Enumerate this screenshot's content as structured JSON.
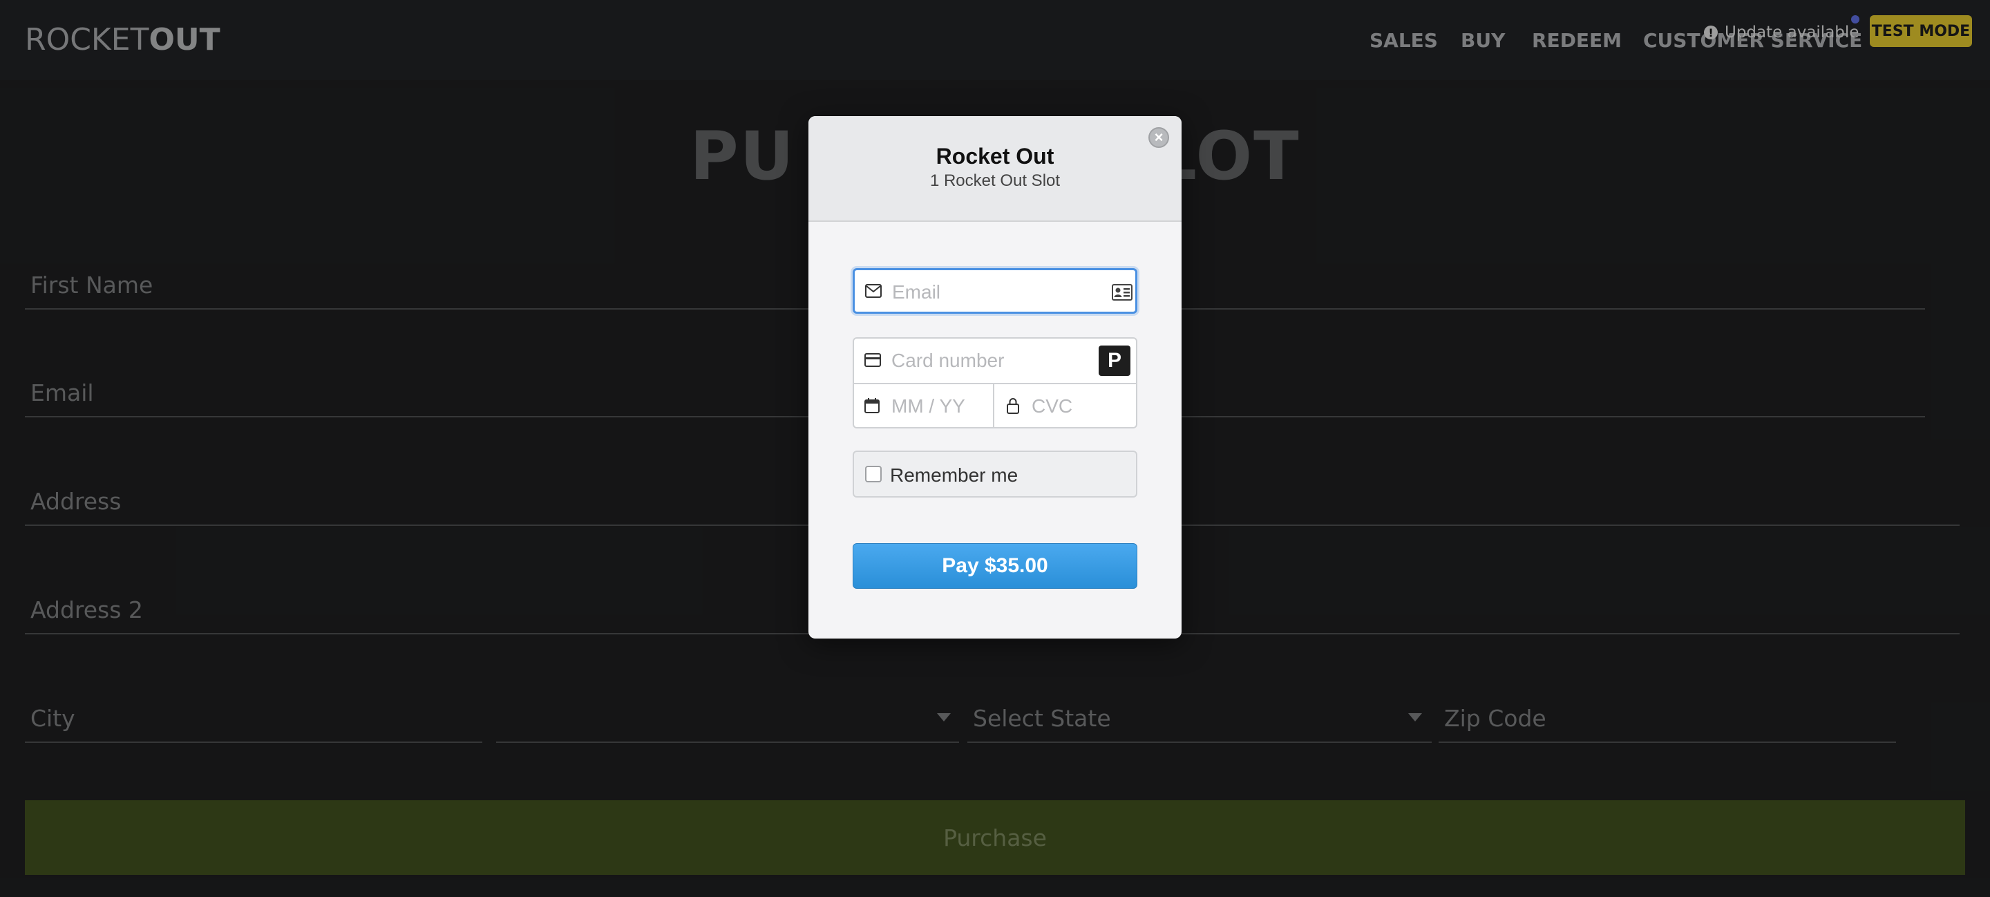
{
  "header": {
    "logo_light": "ROCKET",
    "logo_bold": "OUT",
    "nav": [
      "SALES",
      "BUY",
      "REDEEM",
      "CUSTOMER SERVICE"
    ],
    "update_label": "Update available",
    "test_mode_label": "TEST MODE"
  },
  "page": {
    "title_left": "PU",
    "title_right": "LOT",
    "fields": {
      "first_name": "First Name",
      "email": "Email",
      "address": "Address",
      "address2": "Address 2",
      "city": "City",
      "country": "",
      "state": "Select State",
      "zip": "Zip Code"
    },
    "purchase_label": "Purchase"
  },
  "modal": {
    "title": "Rocket Out",
    "subtitle": "1 Rocket Out Slot",
    "email_placeholder": "Email",
    "card_placeholder": "Card number",
    "expiry_placeholder": "MM / YY",
    "cvc_placeholder": "CVC",
    "remember_label": "Remember me",
    "pay_label": "Pay $35.00",
    "p_badge": "P"
  },
  "colors": {
    "accent": "#2a8fd8",
    "test_mode": "#ffe135",
    "purchase": "#4a5b23"
  }
}
